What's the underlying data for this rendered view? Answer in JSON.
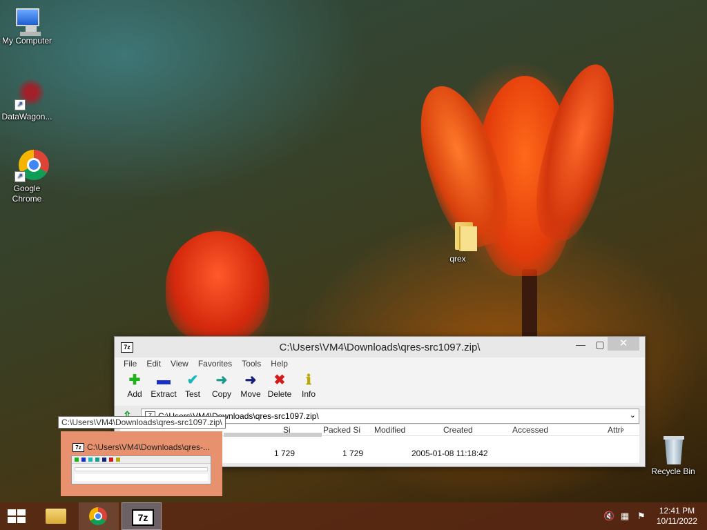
{
  "desktop": {
    "icons": [
      {
        "label": "My Computer",
        "icon": "computer-icon"
      },
      {
        "label": "DataWagon...",
        "icon": "datawagon-icon"
      },
      {
        "label": "Google Chrome",
        "icon": "chrome-icon"
      },
      {
        "label": "qrex",
        "icon": "folder-icon"
      },
      {
        "label": "Recycle Bin",
        "icon": "recycle-bin-icon"
      }
    ]
  },
  "window": {
    "app_icon": "7z",
    "title": "C:\\Users\\VM4\\Downloads\\qres-src1097.zip\\",
    "controls": {
      "minimize": "—",
      "maximize": "▢",
      "close": "✕"
    },
    "menu": [
      "File",
      "Edit",
      "View",
      "Favorites",
      "Tools",
      "Help"
    ],
    "toolbar": [
      {
        "label": "Add",
        "glyph": "✚",
        "color": "#1db31d"
      },
      {
        "label": "Extract",
        "glyph": "▬",
        "color": "#1a2fc9"
      },
      {
        "label": "Test",
        "glyph": "✔",
        "color": "#19b8b8"
      },
      {
        "label": "Copy",
        "glyph": "➜",
        "color": "#1a9a8a"
      },
      {
        "label": "Move",
        "glyph": "➜",
        "color": "#14207a"
      },
      {
        "label": "Delete",
        "glyph": "✖",
        "color": "#d41a1a"
      },
      {
        "label": "Info",
        "glyph": "ℹ",
        "color": "#b8a800"
      }
    ],
    "address": "C:\\Users\\VM4\\Downloads\\qres-src1097.zip\\",
    "columns": [
      "Si",
      "Packed Si",
      "Modified",
      "Created",
      "Accessed",
      "Attri"
    ],
    "row": {
      "size": "1 729",
      "packed": "1 729",
      "modified": "2005-01-08 11:18:42"
    }
  },
  "taskbar_preview": {
    "tooltip": "C:\\Users\\VM4\\Downloads\\qres-src1097.zip\\",
    "title": "C:\\Users\\VM4\\Downloads\\qres-..."
  },
  "taskbar": {
    "items": [
      "start-icon",
      "file-explorer-icon",
      "chrome-icon",
      "7zip-icon"
    ],
    "tray": [
      "speaker-muted-icon",
      "network-icon",
      "action-center-icon"
    ],
    "time": "12:41 PM",
    "date": "10/11/2022"
  },
  "colors": {
    "taskbar": "#5a2814",
    "preview": "#e8916f"
  }
}
